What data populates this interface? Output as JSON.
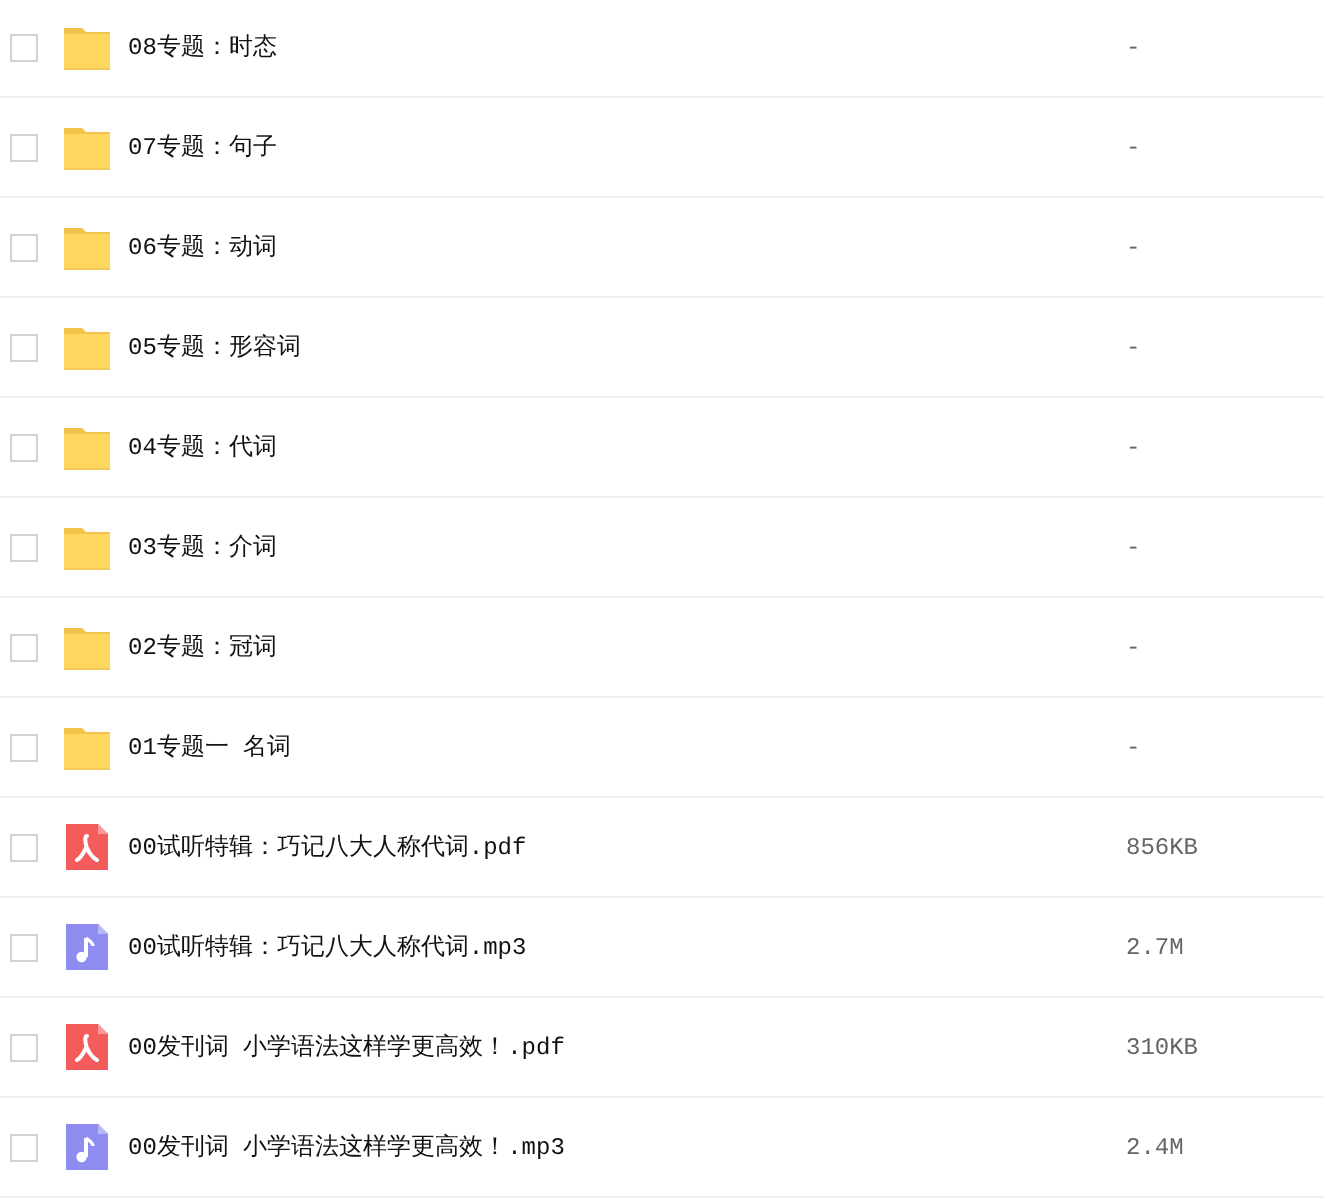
{
  "files": [
    {
      "kind": "folder",
      "name": "08专题：时态",
      "size": "-",
      "checked": false
    },
    {
      "kind": "folder",
      "name": "07专题：句子",
      "size": "-",
      "checked": false
    },
    {
      "kind": "folder",
      "name": "06专题：动词",
      "size": "-",
      "checked": false
    },
    {
      "kind": "folder",
      "name": "05专题：形容词",
      "size": "-",
      "checked": false
    },
    {
      "kind": "folder",
      "name": "04专题：代词",
      "size": "-",
      "checked": false
    },
    {
      "kind": "folder",
      "name": "03专题：介词",
      "size": "-",
      "checked": false
    },
    {
      "kind": "folder",
      "name": "02专题：冠词",
      "size": "-",
      "checked": false
    },
    {
      "kind": "folder",
      "name": "01专题一 名词",
      "size": "-",
      "checked": false
    },
    {
      "kind": "pdf",
      "name": "00试听特辑：巧记八大人称代词.pdf",
      "size": "856KB",
      "checked": false
    },
    {
      "kind": "audio",
      "name": "00试听特辑：巧记八大人称代词.mp3",
      "size": "2.7M",
      "checked": false
    },
    {
      "kind": "pdf",
      "name": "00发刊词 小学语法这样学更高效！.pdf",
      "size": "310KB",
      "checked": false
    },
    {
      "kind": "audio",
      "name": "00发刊词 小学语法这样学更高效！.mp3",
      "size": "2.4M",
      "checked": false
    }
  ]
}
